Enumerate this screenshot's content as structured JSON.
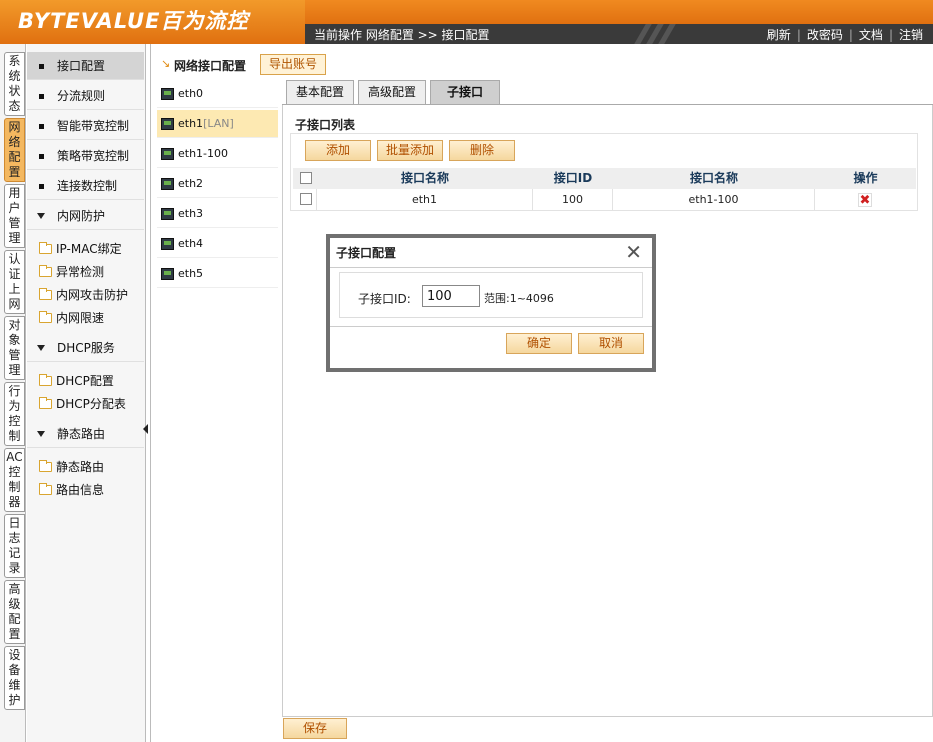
{
  "header": {
    "logo": "BYTEVALUE百为流控",
    "breadcrumb": "当前操作  网络配置 >> 接口配置",
    "nav": [
      "刷新",
      "改密码",
      "文档",
      "注销"
    ]
  },
  "vtabs": [
    "系统状态",
    "网络配置",
    "用户管理",
    "认证上网",
    "对象管理",
    "行为控制",
    "AC控制器",
    "日志记录",
    "高级配置",
    "设备维护"
  ],
  "menu": {
    "items": [
      {
        "label": "接口配置"
      },
      {
        "label": "分流规则"
      },
      {
        "label": "智能带宽控制"
      },
      {
        "label": "策略带宽控制"
      },
      {
        "label": "连接数控制"
      }
    ],
    "groups": [
      {
        "label": "内网防护",
        "children": [
          "IP-MAC绑定",
          "异常检测",
          "内网攻击防护",
          "内网限速"
        ]
      },
      {
        "label": "DHCP服务",
        "children": [
          "DHCP配置",
          "DHCP分配表"
        ]
      },
      {
        "label": "静态路由",
        "children": [
          "静态路由",
          "路由信息"
        ]
      }
    ]
  },
  "content": {
    "title": "网络接口配置",
    "export_label": "导出账号",
    "interfaces": [
      {
        "name": "eth0",
        "tag": ""
      },
      {
        "name": "eth1",
        "tag": "[LAN]"
      },
      {
        "name": "eth1-100",
        "tag": ""
      },
      {
        "name": "eth2",
        "tag": ""
      },
      {
        "name": "eth3",
        "tag": ""
      },
      {
        "name": "eth4",
        "tag": ""
      },
      {
        "name": "eth5",
        "tag": ""
      }
    ],
    "tabs": [
      "基本配置",
      "高级配置",
      "子接口"
    ],
    "sub_title": "子接口列表",
    "buttons": {
      "add": "添加",
      "batch_add": "批量添加",
      "delete": "删除"
    },
    "table": {
      "headers": [
        "接口名称",
        "接口ID",
        "接口名称",
        "操作"
      ],
      "rows": [
        {
          "iface": "eth1",
          "id": "100",
          "name": "eth1-100"
        }
      ]
    },
    "save_label": "保存"
  },
  "dialog": {
    "title": "子接口配置",
    "label": "子接口ID:",
    "input_value": "100",
    "range": "范围:1~4096",
    "ok": "确定",
    "cancel": "取消"
  }
}
